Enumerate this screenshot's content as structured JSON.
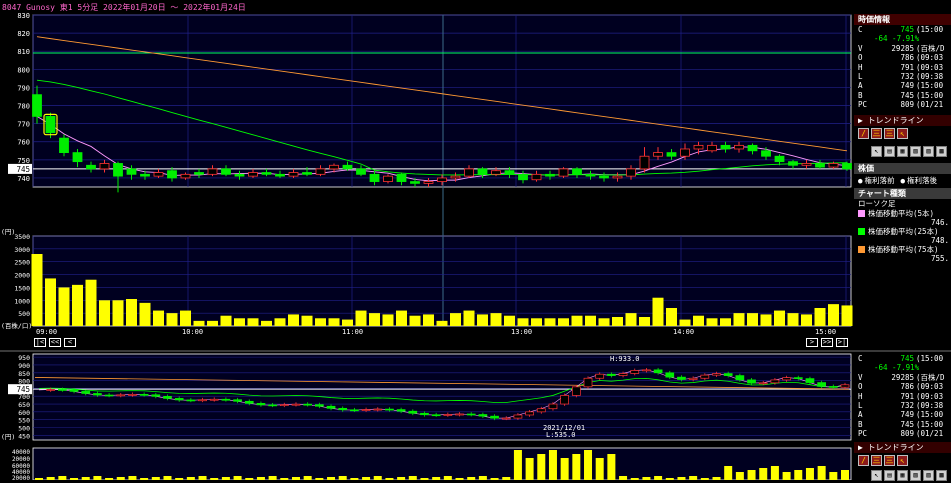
{
  "title": "8047 Gunosy 東1 5分足 2022年01月20日 〜 2022年01月24日",
  "quote": {
    "header": "時価情報",
    "rows": [
      {
        "label": "C",
        "value": "745",
        "time": "(15:00"
      },
      {
        "label": "",
        "value": "-64 -7.91%",
        "time": ""
      },
      {
        "label": "V",
        "value": "29285",
        "time": "(百株/D"
      },
      {
        "label": "O",
        "value": "786",
        "time": "(09:03"
      },
      {
        "label": "H",
        "value": "791",
        "time": "(09:03"
      },
      {
        "label": "L",
        "value": "732",
        "time": "(09:38"
      },
      {
        "label": "A",
        "value": "749",
        "time": "(15:00"
      },
      {
        "label": "B",
        "value": "745",
        "time": "(15:00"
      },
      {
        "label": "PC",
        "value": "809",
        "time": "(01/21"
      }
    ]
  },
  "quote2": {
    "rows": [
      {
        "label": "C",
        "value": "745",
        "time": "(15:00"
      },
      {
        "label": "",
        "value": "-64 -7.91%",
        "time": ""
      },
      {
        "label": "V",
        "value": "29285",
        "time": "(百株/D"
      },
      {
        "label": "O",
        "value": "786",
        "time": "(09:03"
      },
      {
        "label": "H",
        "value": "791",
        "time": "(09:03"
      },
      {
        "label": "L",
        "value": "732",
        "time": "(09:38"
      },
      {
        "label": "A",
        "value": "749",
        "time": "(15:00"
      },
      {
        "label": "B",
        "value": "745",
        "time": "(15:00"
      },
      {
        "label": "PC",
        "value": "809",
        "time": "(01/21"
      }
    ]
  },
  "trendline": {
    "label": "トレンドライン",
    "buttons": [
      "/",
      "三",
      "三",
      "↖"
    ]
  },
  "tools": {
    "buttons": [
      "↖",
      "▤",
      "▦",
      "▧",
      "▨",
      "▩"
    ]
  },
  "price_section": {
    "header": "株価",
    "radio1": "権利落前",
    "radio2": "権利落後"
  },
  "chart_type": {
    "header": "チャート種類",
    "type_label": "ローソク足",
    "ma": [
      {
        "label": "株価移動平均(5本)",
        "value": "746.",
        "color": "#ff99ff"
      },
      {
        "label": "株価移動平均(25本)",
        "value": "748.",
        "color": "#00ff00"
      },
      {
        "label": "株価移動平均(75本)",
        "value": "755.",
        "color": "#ff9933"
      }
    ]
  },
  "nav": {
    "first": "|<",
    "prevfast": "<<",
    "prev": "<",
    "next": ">",
    "nextfast": ">>",
    "last": ">|"
  },
  "main_chart": {
    "price_ticks": [
      "830",
      "820",
      "810",
      "800",
      "790",
      "780",
      "770",
      "760",
      "750",
      "740"
    ],
    "current_price_label": "745",
    "volume_ticks": [
      "(円)",
      "3500",
      "3000",
      "2500",
      "2000",
      "1500",
      "1000",
      "500",
      "(百株/口)"
    ],
    "time_ticks": [
      "09:00",
      "10:00",
      "11:00",
      "13:00",
      "14:00",
      "15:00"
    ]
  },
  "chart_data": [
    {
      "type": "candlestick",
      "timeframe": "5分足",
      "ylim": [
        735,
        830
      ],
      "reference_line": 809,
      "last_price": 745,
      "x": [
        "09:00",
        "09:05",
        "09:10",
        "09:15",
        "09:20",
        "09:25",
        "09:30",
        "09:35",
        "09:40",
        "09:45",
        "09:50",
        "09:55",
        "10:00",
        "10:05",
        "10:10",
        "10:15",
        "10:20",
        "10:25",
        "10:30",
        "10:35",
        "10:40",
        "10:45",
        "10:50",
        "10:55",
        "11:00",
        "11:05",
        "11:10",
        "11:15",
        "11:20",
        "11:25",
        "12:30",
        "12:35",
        "12:40",
        "12:45",
        "12:50",
        "12:55",
        "13:00",
        "13:05",
        "13:10",
        "13:15",
        "13:20",
        "13:25",
        "13:30",
        "13:35",
        "13:40",
        "13:45",
        "13:50",
        "13:55",
        "14:00",
        "14:05",
        "14:10",
        "14:15",
        "14:20",
        "14:25",
        "14:30",
        "14:35",
        "14:40",
        "14:45",
        "14:50",
        "14:55",
        "15:00"
      ],
      "open": [
        786,
        774,
        762,
        754,
        747,
        745,
        748,
        745,
        742,
        741,
        744,
        740,
        743,
        742,
        745,
        742,
        741,
        743,
        742,
        741,
        743,
        742,
        745,
        747,
        745,
        742,
        738,
        742,
        738,
        737,
        738,
        740,
        741,
        745,
        742,
        744,
        742,
        739,
        742,
        741,
        745,
        742,
        741,
        740,
        741,
        745,
        752,
        754,
        752,
        756,
        755,
        758,
        756,
        758,
        755,
        752,
        749,
        747,
        748,
        746,
        748
      ],
      "close": [
        774,
        765,
        754,
        749,
        745,
        748,
        741,
        742,
        741,
        743,
        740,
        742,
        742,
        745,
        742,
        741,
        743,
        742,
        741,
        743,
        742,
        745,
        747,
        745,
        742,
        738,
        741,
        738,
        737,
        738,
        740,
        741,
        745,
        742,
        744,
        742,
        739,
        742,
        741,
        745,
        742,
        741,
        740,
        741,
        745,
        752,
        754,
        752,
        756,
        758,
        758,
        756,
        758,
        755,
        752,
        749,
        747,
        748,
        746,
        748,
        745
      ],
      "high": [
        791,
        776,
        764,
        756,
        749,
        750,
        749,
        747,
        744,
        745,
        746,
        743,
        745,
        747,
        747,
        744,
        745,
        745,
        744,
        745,
        746,
        747,
        748,
        749,
        747,
        744,
        742,
        743,
        740,
        740,
        742,
        743,
        747,
        746,
        746,
        746,
        744,
        744,
        744,
        746,
        746,
        744,
        743,
        743,
        747,
        757,
        757,
        756,
        759,
        760,
        760,
        760,
        760,
        759,
        757,
        753,
        750,
        750,
        750,
        749,
        749
      ],
      "low": [
        770,
        762,
        752,
        746,
        743,
        743,
        732,
        739,
        739,
        740,
        738,
        739,
        740,
        741,
        741,
        739,
        740,
        741,
        740,
        740,
        741,
        741,
        743,
        744,
        741,
        736,
        737,
        736,
        735,
        735,
        736,
        738,
        740,
        740,
        741,
        740,
        737,
        738,
        739,
        740,
        740,
        739,
        738,
        738,
        739,
        743,
        750,
        750,
        750,
        753,
        754,
        754,
        754,
        753,
        750,
        747,
        745,
        745,
        745,
        745,
        744
      ],
      "series": [
        {
          "name": "株価移動平均(5本)",
          "color": "#ff99ff"
        },
        {
          "name": "株価移動平均(25本)",
          "color": "#00ff00"
        },
        {
          "name": "株価移動平均(75本)",
          "color": "#ff9933"
        }
      ],
      "ma75": [
        818,
        755
      ]
    },
    {
      "type": "bar",
      "ylim": [
        0,
        3500
      ],
      "values": [
        2800,
        1850,
        1500,
        1600,
        1800,
        1000,
        1000,
        1050,
        900,
        600,
        500,
        600,
        200,
        200,
        400,
        300,
        300,
        200,
        300,
        450,
        400,
        300,
        300,
        250,
        600,
        500,
        450,
        600,
        400,
        450,
        200,
        500,
        600,
        450,
        500,
        400,
        300,
        300,
        300,
        300,
        400,
        400,
        300,
        350,
        500,
        350,
        1100,
        700,
        250,
        400,
        300,
        300,
        500,
        500,
        450,
        600,
        500,
        450,
        700,
        850,
        800
      ]
    }
  ],
  "lower_chart": {
    "price_ticks": [
      "950",
      "900",
      "850",
      "800",
      "750",
      "700",
      "650",
      "600",
      "550",
      "500",
      "450",
      "(円)"
    ],
    "current_price_label": "745",
    "high_label": "H:933.0",
    "low_date": "2021/12/01",
    "low_label": "L:535.0",
    "volume_ticks": [
      "40000",
      "20000",
      "60000",
      "40000",
      "20000"
    ]
  }
}
